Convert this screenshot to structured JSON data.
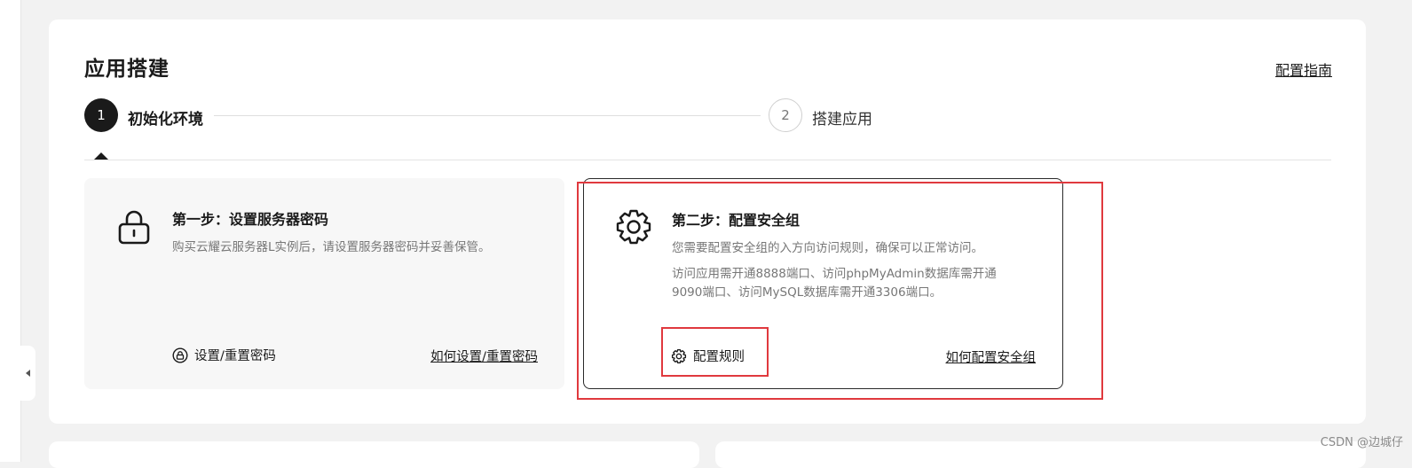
{
  "panel": {
    "title": "应用搭建",
    "guide_link": "配置指南"
  },
  "stepper": {
    "steps": [
      {
        "number": "1",
        "label": "初始化环境",
        "state": "active"
      },
      {
        "number": "2",
        "label": "搭建应用",
        "state": "inactive"
      }
    ]
  },
  "cards": [
    {
      "title": "第一步：设置服务器密码",
      "desc": [
        "购买云耀云服务器L实例后，请设置服务器密码并妥善保管。"
      ],
      "action_label": "设置/重置密码",
      "help_link": "如何设置/重置密码",
      "icon": "lock-icon"
    },
    {
      "title": "第二步：配置安全组",
      "desc": [
        "您需要配置安全组的入方向访问规则，确保可以正常访问。",
        "访问应用需开通8888端口、访问phpMyAdmin数据库需开通9090端口、访问MySQL数据库需开通3306端口。"
      ],
      "action_label": "配置规则",
      "help_link": "如何配置安全组",
      "icon": "gear-icon"
    }
  ],
  "watermark": "CSDN @边城仔",
  "colors": {
    "highlight": "#e0393e",
    "active_step": "#1a1a1a",
    "background": "#f2f2f2"
  }
}
